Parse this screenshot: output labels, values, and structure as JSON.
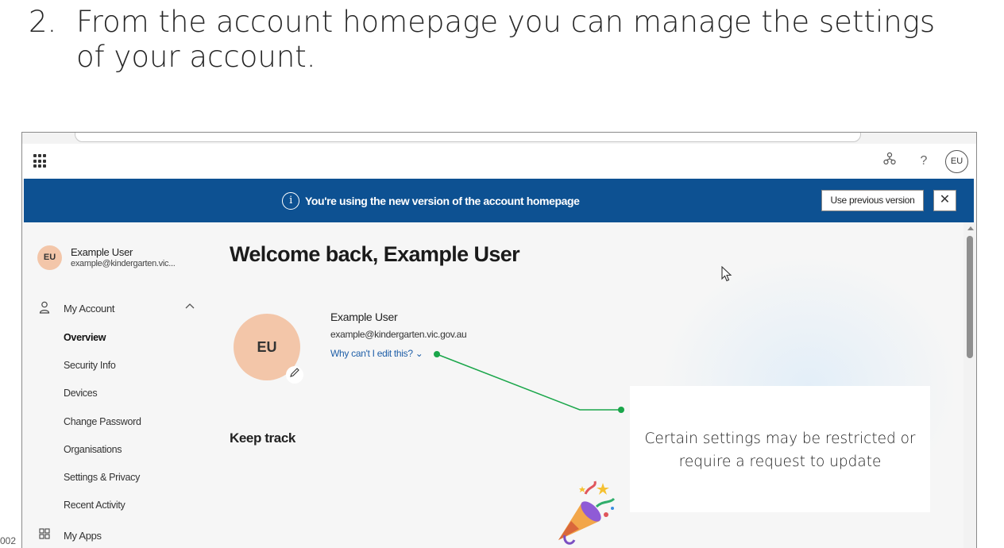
{
  "slide": {
    "step_number": "2.",
    "heading": "From the account homepage you can manage the settings of your account.",
    "page_number": "002"
  },
  "topbar": {
    "avatar_initials": "EU",
    "help_glyph": "?"
  },
  "banner": {
    "message": "You're using the new version of the account homepage",
    "info_glyph": "i",
    "previous_button_label": "Use previous version",
    "close_glyph": "✕",
    "background_color": "#0d5192"
  },
  "sidebar": {
    "user": {
      "initials": "EU",
      "name": "Example User",
      "email": "example@kindergarten.vic..."
    },
    "my_account_label": "My Account",
    "sub_items": [
      {
        "label": "Overview"
      },
      {
        "label": "Security Info"
      },
      {
        "label": "Devices"
      },
      {
        "label": "Change Password"
      },
      {
        "label": "Organisations"
      },
      {
        "label": "Settings & Privacy"
      },
      {
        "label": "Recent Activity"
      }
    ],
    "my_apps_label": "My Apps"
  },
  "main": {
    "welcome": "Welcome back, Example User",
    "profile": {
      "initials": "EU",
      "name": "Example User",
      "email": "example@kindergarten.vic.gov.au",
      "edit_link": "Why can't I edit this? ⌄"
    },
    "keep_track": "Keep track"
  },
  "annotation": {
    "text": "Certain settings may be restricted or require a request to update",
    "line_color": "#1aa64a"
  }
}
